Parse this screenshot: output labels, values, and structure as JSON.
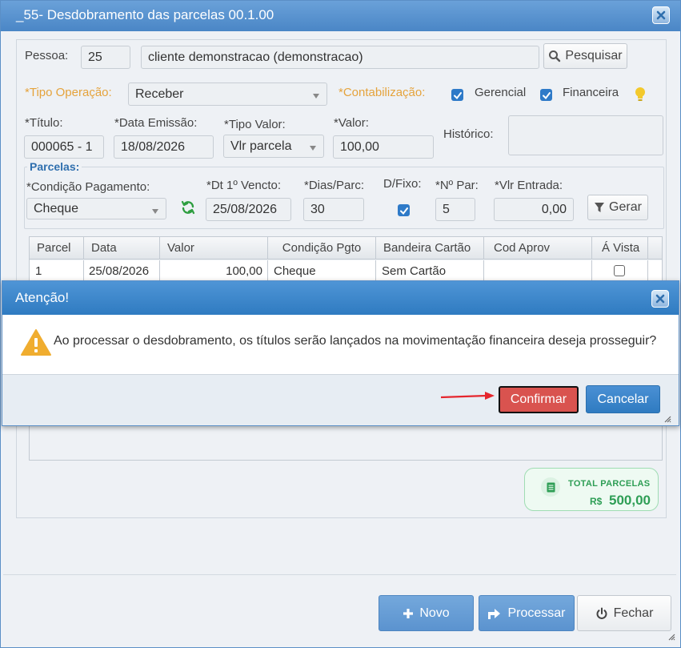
{
  "window": {
    "title": "_55- Desdobramento das parcelas 00.1.00"
  },
  "form": {
    "pessoa_label": "Pessoa:",
    "pessoa_code": "25",
    "pessoa_name": "cliente demonstracao (demonstracao)",
    "pesquisar_label": "Pesquisar",
    "tipo_operacao_label": "*Tipo Operação:",
    "tipo_operacao_value": "Receber",
    "contabilizacao_label": "*Contabilização:",
    "gerencial_label": "Gerencial",
    "financeira_label": "Financeira",
    "titulo_label": "*Título:",
    "titulo_value": "000065 - 1",
    "data_emissao_label": "*Data Emissão:",
    "data_emissao_value": "18/08/2026",
    "tipo_valor_label": "*Tipo Valor:",
    "tipo_valor_value": "Vlr parcela",
    "valor_label": "*Valor:",
    "valor_value": "100,00",
    "historico_label": "Histórico:"
  },
  "parcelas": {
    "legend": "Parcelas:",
    "condicao_label": "*Condição Pagamento:",
    "condicao_value": "Cheque",
    "dt_vencto_label": "*Dt 1º Vencto:",
    "dt_vencto_value": "25/08/2026",
    "dias_label": "*Dias/Parc:",
    "dias_value": "30",
    "dfixo_label": "D/Fixo:",
    "npar_label": "*Nº Par:",
    "npar_value": "5",
    "vlr_entrada_label": "*Vlr Entrada:",
    "vlr_entrada_value": "0,00",
    "gerar_label": "Gerar"
  },
  "grid": {
    "headers": [
      "Parcel",
      "Data",
      "Valor",
      "Condição Pgto",
      "Bandeira Cartão",
      "Cod Aprov",
      "Á Vista"
    ],
    "row": [
      "1",
      "25/08/2026",
      "100,00",
      "Cheque",
      "Sem Cartão",
      ""
    ]
  },
  "total": {
    "label": "TOTAL PARCELAS",
    "currency": "R$",
    "value": "500,00"
  },
  "buttons": {
    "novo": "Novo",
    "processar": "Processar",
    "fechar": "Fechar"
  },
  "dialog": {
    "title": "Atenção!",
    "message": "Ao processar o desdobramento, os títulos serão lançados na movimentação financeira deseja prosseguir?",
    "confirm": "Confirmar",
    "cancel": "Cancelar"
  },
  "colors": {
    "accent": "#2f7bc1",
    "orange_label": "#e5a33c",
    "confirm_red": "#d9534f",
    "total_green": "#2e9e55"
  }
}
